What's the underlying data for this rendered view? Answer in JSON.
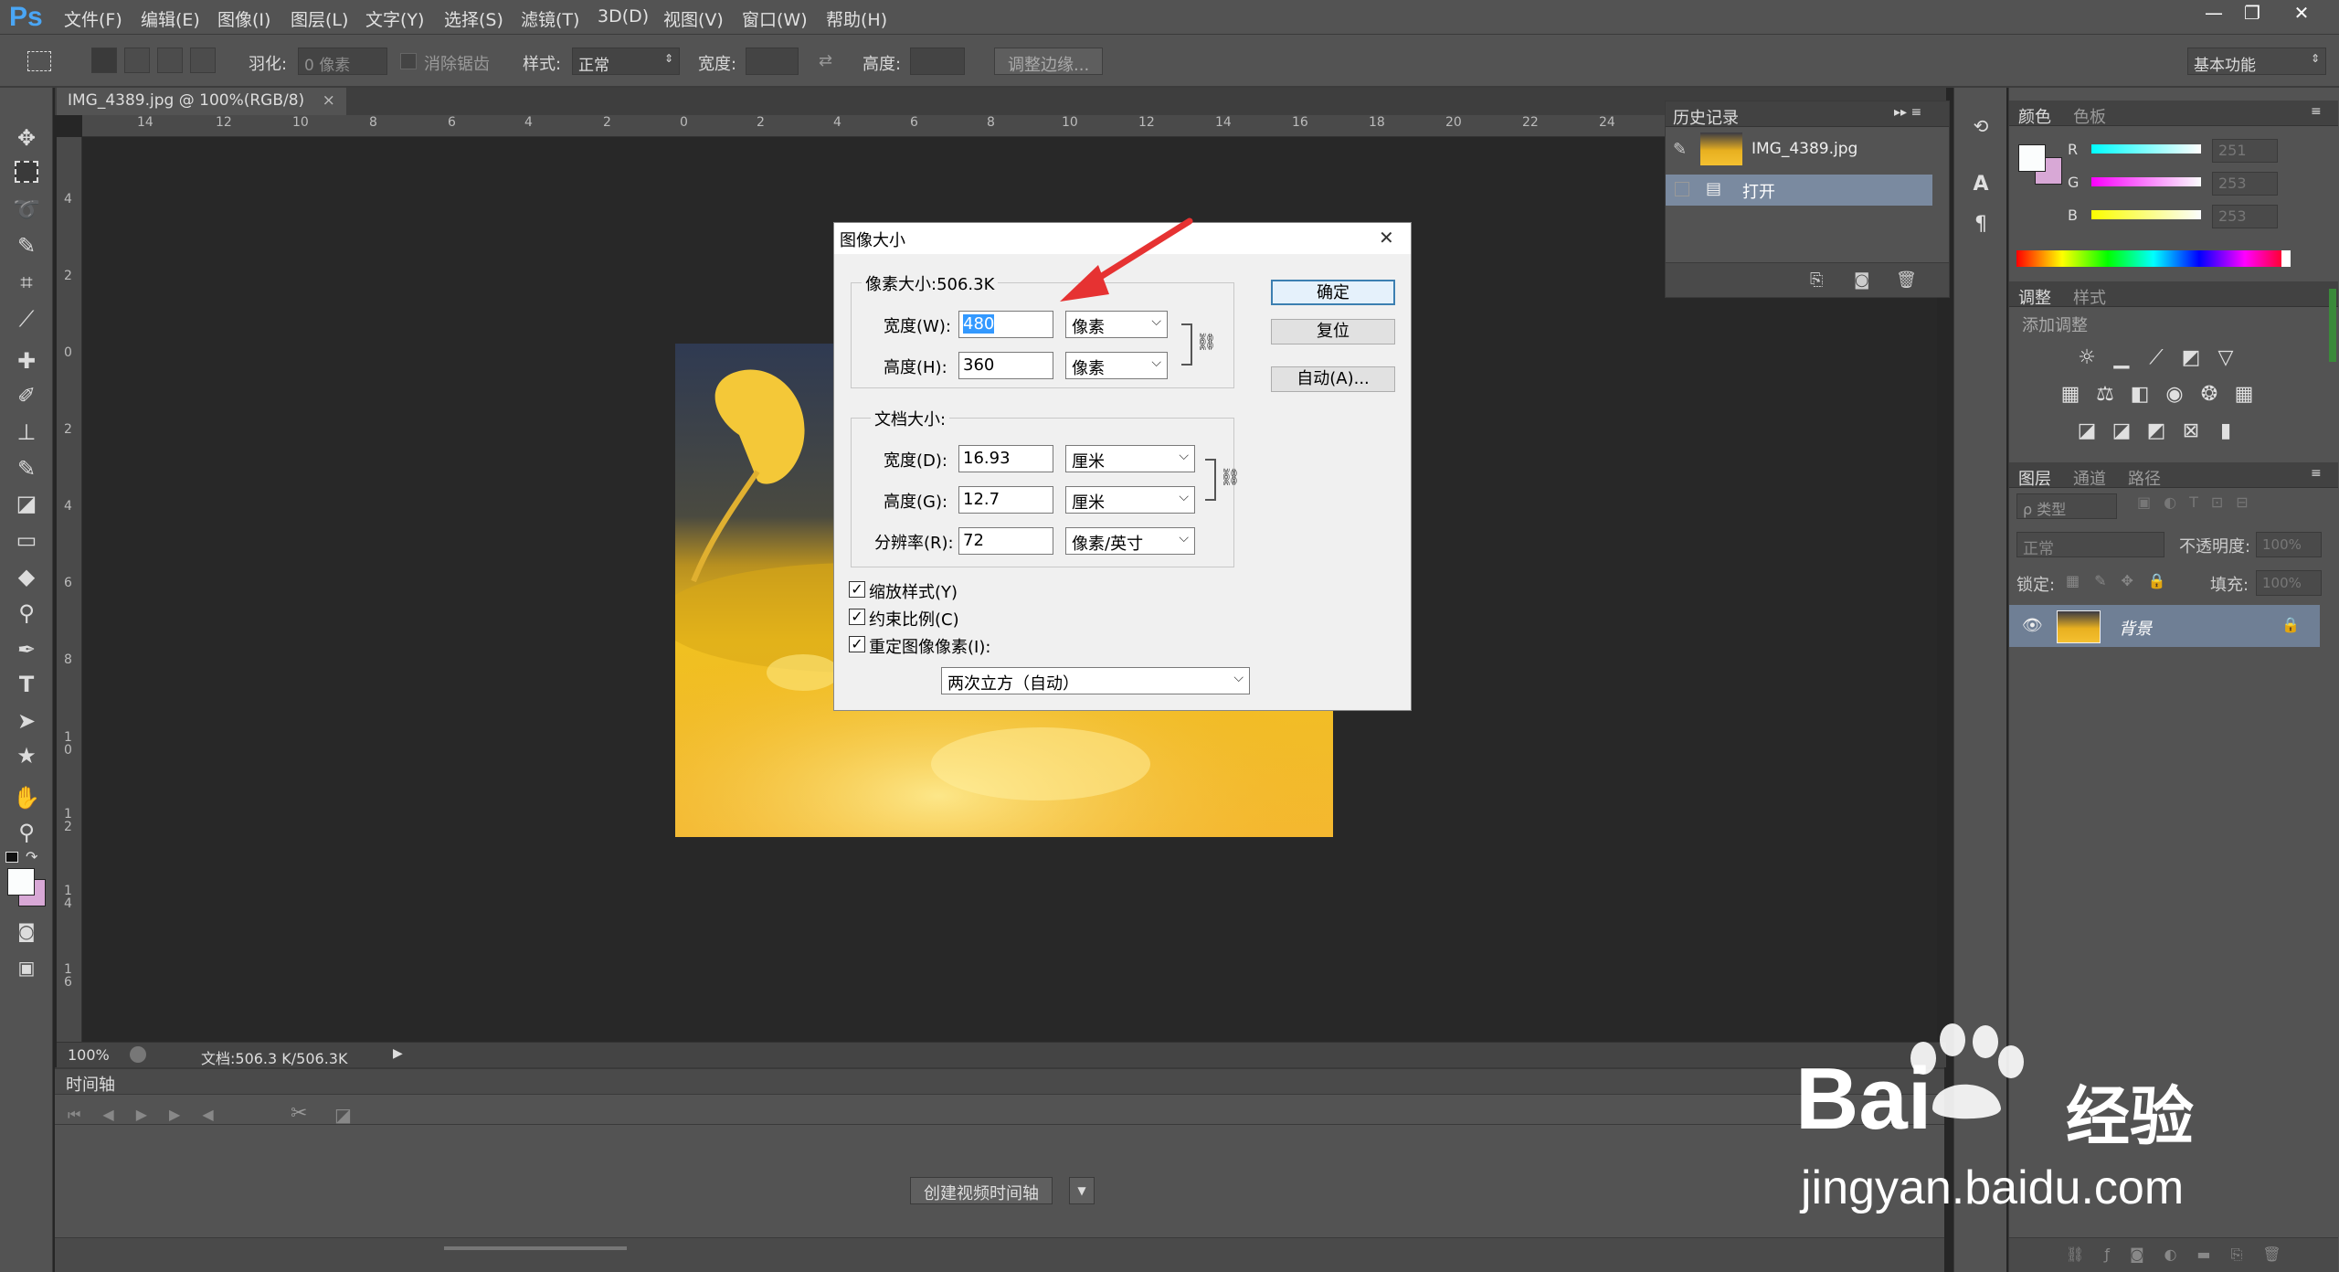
{
  "app": {
    "logo": "Ps"
  },
  "menu": [
    "文件(F)",
    "编辑(E)",
    "图像(I)",
    "图层(L)",
    "文字(Y)",
    "选择(S)",
    "滤镜(T)",
    "3D(D)",
    "视图(V)",
    "窗口(W)",
    "帮助(H)"
  ],
  "window_controls": {
    "minimize": "—",
    "restore": "❐",
    "close": "✕"
  },
  "options": {
    "feather_label": "羽化:",
    "feather_value": "0 像素",
    "antialias_label": "消除锯齿",
    "style_label": "样式:",
    "style_value": "正常",
    "width_label": "宽度:",
    "height_label": "高度:",
    "refine_edge": "调整边缘...",
    "workspace": "基本功能"
  },
  "document": {
    "tab_title": "IMG_4389.jpg @ 100%(RGB/8)",
    "tab_close": "×",
    "ruler_h": [
      "14",
      "12",
      "10",
      "8",
      "6",
      "4",
      "2",
      "0",
      "2",
      "4",
      "6",
      "8",
      "10",
      "12",
      "14",
      "16",
      "18",
      "20",
      "22",
      "24"
    ],
    "ruler_v": [
      "4",
      "2",
      "0",
      "2",
      "4",
      "6",
      "8",
      "1 0",
      "1 2",
      "1 4",
      "1 6"
    ],
    "zoom": "100%",
    "doc_info": "文档:506.3 K/506.3K"
  },
  "timeline": {
    "title": "时间轴",
    "create_button": "创建视频时间轴"
  },
  "dialog": {
    "title": "图像大小",
    "close": "✕",
    "pixel_size_label": "像素大小:506.3K",
    "width_label": "宽度(W):",
    "width_value": "480",
    "height_label": "高度(H):",
    "height_value": "360",
    "pixel_unit": "像素",
    "doc_size_label": "文档大小:",
    "doc_width_label": "宽度(D):",
    "doc_width_value": "16.93",
    "doc_height_label": "高度(G):",
    "doc_height_value": "12.7",
    "doc_unit": "厘米",
    "resolution_label": "分辨率(R):",
    "resolution_value": "72",
    "resolution_unit": "像素/英寸",
    "scale_styles": "缩放样式(Y)",
    "constrain": "约束比例(C)",
    "resample": "重定图像像素(I):",
    "resample_method": "两次立方（自动）",
    "ok": "确定",
    "reset": "复位",
    "auto": "自动(A)..."
  },
  "history": {
    "tab": "历史记录",
    "snapshot": "IMG_4389.jpg",
    "step": "打开"
  },
  "color_panel": {
    "tabs": [
      "颜色",
      "色板"
    ],
    "channels": [
      {
        "name": "R",
        "value": "251"
      },
      {
        "name": "G",
        "value": "253"
      },
      {
        "name": "B",
        "value": "253"
      }
    ]
  },
  "adjustments": {
    "tabs": [
      "调整",
      "样式"
    ],
    "add_label": "添加调整"
  },
  "layers": {
    "tabs": [
      "图层",
      "通道",
      "路径"
    ],
    "kind": "ρ 类型",
    "blend_mode": "正常",
    "opacity_label": "不透明度:",
    "opacity_value": "100%",
    "lock_label": "锁定:",
    "fill_label": "填充:",
    "fill_value": "100%",
    "layer_name": "背景"
  },
  "watermark": {
    "brand_left": "Bai",
    "brand_right": "经验",
    "url": "jingyan.baidu.com"
  }
}
